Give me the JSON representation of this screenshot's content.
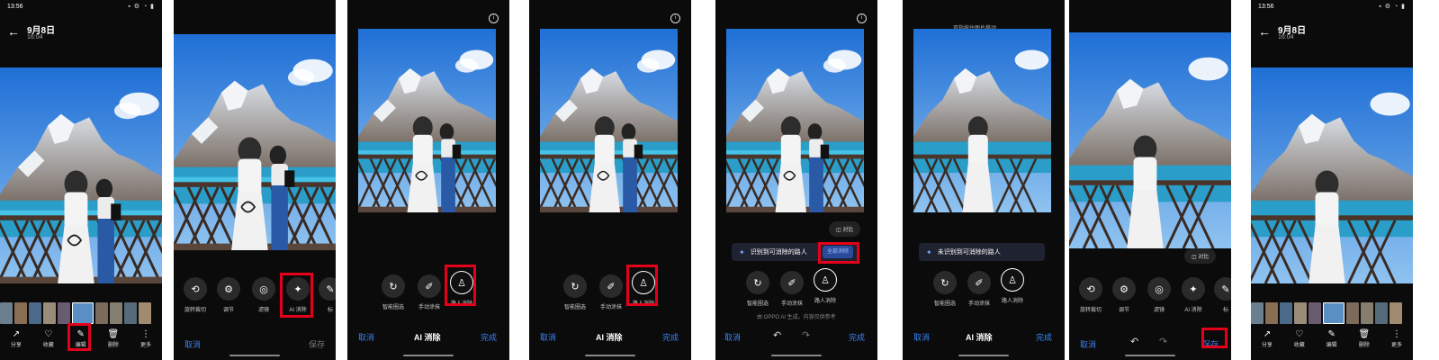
{
  "panel1": {
    "status_time": "13:56",
    "status_icons": "▪ ⚙ ◔ ▮",
    "back": "←",
    "date": "9月8日",
    "time": "16:04",
    "nav": [
      {
        "icon": "↗",
        "label": "分享"
      },
      {
        "icon": "♡",
        "label": "收藏"
      },
      {
        "icon": "✎",
        "label": "编辑"
      },
      {
        "icon": "🗑",
        "label": "删除"
      },
      {
        "icon": "⋮",
        "label": "更多"
      }
    ]
  },
  "panel2": {
    "tools": [
      {
        "icon": "⟲",
        "label": "旋转裁切"
      },
      {
        "icon": "⚙",
        "label": "调节"
      },
      {
        "icon": "◎",
        "label": "滤镜"
      },
      {
        "icon": "✦",
        "label": "AI 消除"
      },
      {
        "icon": "✎",
        "label": "标"
      }
    ],
    "cancel": "取消",
    "save": "保存"
  },
  "panel3": {
    "tools": [
      {
        "icon": "↻",
        "label": "智能圈选"
      },
      {
        "icon": "✐",
        "label": "手动涂抹"
      },
      {
        "icon": "♙",
        "label": "路人消除"
      }
    ],
    "cancel": "取消",
    "title": "AI 消除",
    "done": "完成"
  },
  "panel4": {
    "tools": [
      {
        "icon": "↻",
        "label": "智能圈选"
      },
      {
        "icon": "✐",
        "label": "手动涂抹"
      },
      {
        "icon": "♙",
        "label": "路人消除"
      }
    ],
    "cancel": "取消",
    "title": "AI 消除",
    "done": "完成"
  },
  "panel5": {
    "compare": "对比",
    "banner": "识别到可消除的路人",
    "all_button": "全部消除",
    "tools": [
      {
        "icon": "↻",
        "label": "智能圈选"
      },
      {
        "icon": "✐",
        "label": "手动涂抹"
      },
      {
        "icon": "♙",
        "label": "路人消除"
      }
    ],
    "hint": "由 OPPO AI 生成，内容仅供参考",
    "cancel": "取消",
    "undo": "↶",
    "redo": "↷",
    "done": "完成"
  },
  "panel6": {
    "top_tip": "双指按住图片移动",
    "banner": "未识别到可消除的路人",
    "tools": [
      {
        "icon": "↻",
        "label": "智能圈选"
      },
      {
        "icon": "✐",
        "label": "手动涂抹"
      },
      {
        "icon": "♙",
        "label": "路人消除"
      }
    ],
    "cancel": "取消",
    "title": "AI 消除",
    "done": "完成"
  },
  "panel7": {
    "compare": "对比",
    "tools": [
      {
        "icon": "⟲",
        "label": "旋转裁切"
      },
      {
        "icon": "⚙",
        "label": "调节"
      },
      {
        "icon": "◎",
        "label": "滤镜"
      },
      {
        "icon": "✦",
        "label": "AI 消除"
      },
      {
        "icon": "✎",
        "label": "标"
      }
    ],
    "cancel": "取消",
    "undo": "↶",
    "redo": "↷",
    "save": "保存"
  },
  "panel8": {
    "status_time": "13:56",
    "status_icons": "▪ ⚙ ◔ ▮",
    "back": "←",
    "date": "9月8日",
    "time": "16:04",
    "nav": [
      {
        "icon": "↗",
        "label": "分享"
      },
      {
        "icon": "♡",
        "label": "收藏"
      },
      {
        "icon": "✎",
        "label": "编辑"
      },
      {
        "icon": "🗑",
        "label": "删除"
      },
      {
        "icon": "⋮",
        "label": "更多"
      }
    ]
  },
  "colors": {
    "accent": "#3b82f6",
    "highlight": "#e4001b",
    "panel_bg": "#0b0b0b"
  }
}
